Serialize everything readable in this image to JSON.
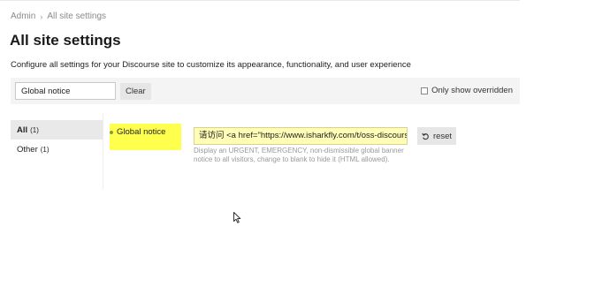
{
  "breadcrumb": {
    "root": "Admin",
    "current": "All site settings"
  },
  "page": {
    "title": "All site settings",
    "description": "Configure all settings for your Discourse site to customize its appearance, functionality, and user experience"
  },
  "filter": {
    "value": "Global notice",
    "clear_label": "Clear",
    "only_overridden_label": "Only show overridden",
    "only_overridden_checked": false
  },
  "categories": [
    {
      "label": "All",
      "count": "(1)",
      "active": true
    },
    {
      "label": "Other",
      "count": "(1)",
      "active": false
    }
  ],
  "setting": {
    "label": "Global notice",
    "value": "请访问 <a href=\"https://www.isharkfly.com/t/oss-discourse/",
    "help": "Display an URGENT, EMERGENCY, non-dismissible global banner notice to all visitors, change to blank to hide it (HTML allowed).",
    "reset_label": "reset",
    "reset_icon": "undo-icon",
    "highlight_color": "#ffff4d"
  }
}
